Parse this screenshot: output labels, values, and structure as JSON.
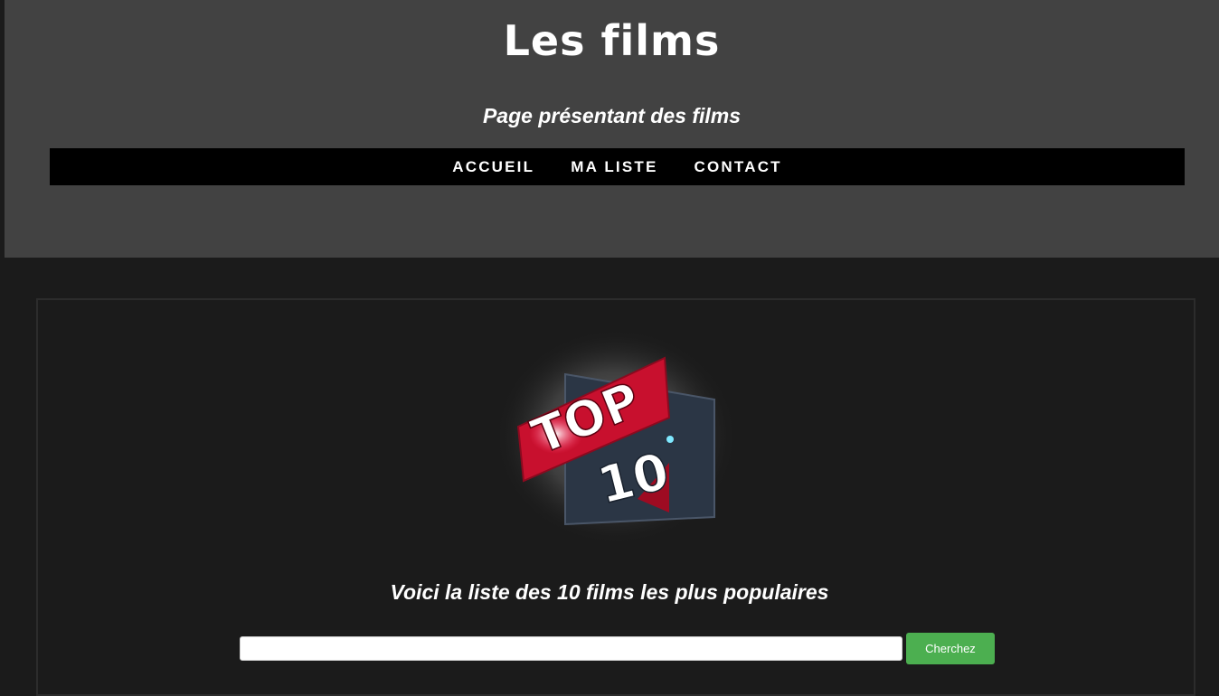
{
  "header": {
    "title": "Les films",
    "subtitle": "Page présentant des films"
  },
  "nav": {
    "items": [
      {
        "label": "ACCUEIL"
      },
      {
        "label": "MA LISTE"
      },
      {
        "label": "CONTACT"
      }
    ]
  },
  "main": {
    "logo": {
      "line1": "TOP",
      "line2": "10"
    },
    "intro": "Voici la liste des 10 films les plus populaires",
    "search": {
      "value": "",
      "placeholder": "",
      "button_label": "Cherchez"
    }
  },
  "colors": {
    "header_bg": "#424242",
    "page_bg": "#1b1b1b",
    "nav_bg": "#000000",
    "button_bg": "#4caf50",
    "logo_red": "#c8102e",
    "logo_navy": "#2b3645"
  }
}
